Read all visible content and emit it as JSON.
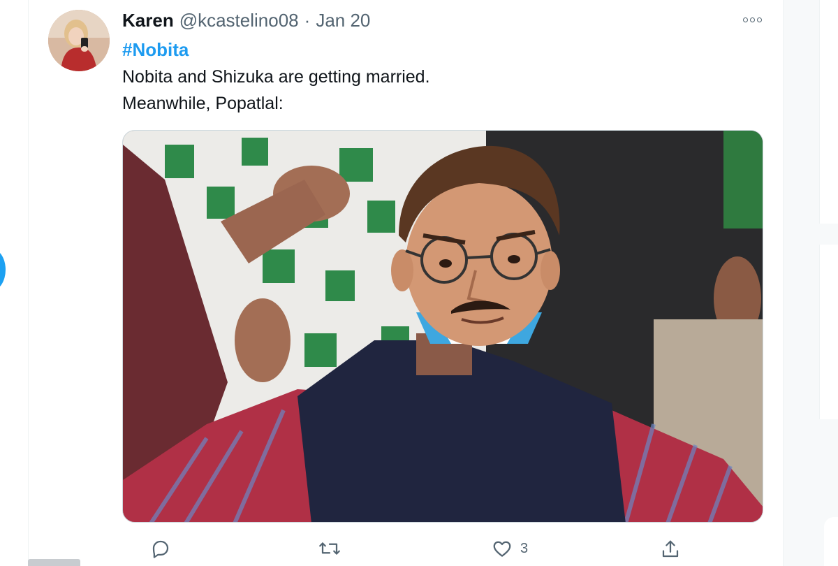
{
  "tweet": {
    "author_name": "Karen",
    "author_handle": "@kcastelino08",
    "separator": "·",
    "date": "Jan 20",
    "hashtag": "#Nobita",
    "text_line1": "Nobita and Shizuka are getting married.",
    "text_line2": "Meanwhile, Popatlal:",
    "media_description": "meme",
    "actions": {
      "reply_count": "",
      "retweet_count": "",
      "like_count": "3",
      "share_count": ""
    }
  },
  "colors": {
    "accent": "#1d9bf0",
    "text_primary": "#0f1419",
    "text_secondary": "#536471"
  },
  "icons": [
    "more-icon",
    "reply-icon",
    "retweet-icon",
    "like-icon",
    "share-icon"
  ]
}
